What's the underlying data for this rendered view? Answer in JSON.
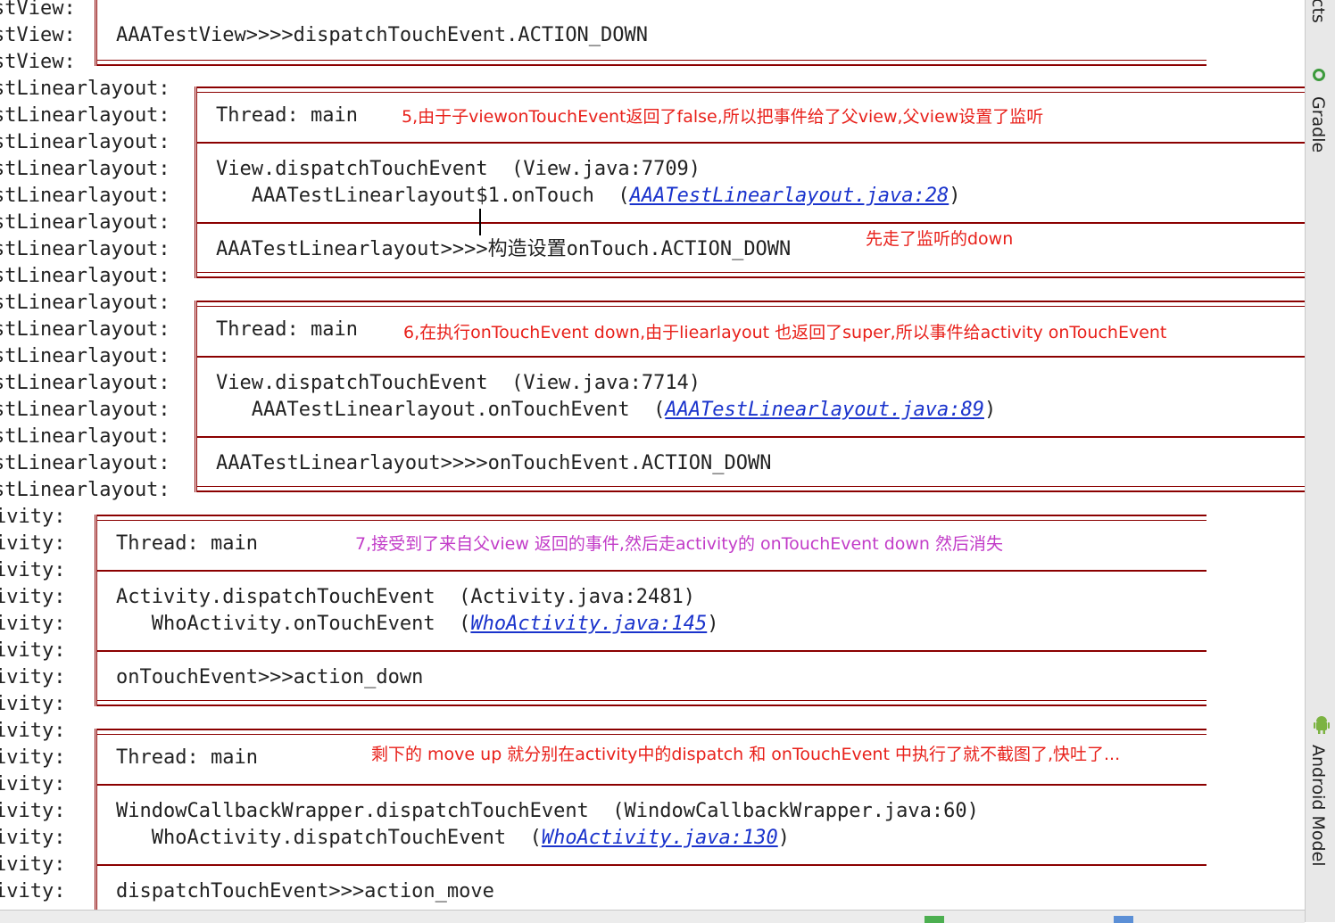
{
  "left_prefixes": {
    "view": "stView:",
    "linear": "stLinearlayout:",
    "activity": "ivity:"
  },
  "sidebar": {
    "tabs": [
      "cts",
      "Gradle",
      "Android Model"
    ]
  },
  "blocks": {
    "block1": {
      "message": "AAATestView>>>>dispatchTouchEvent.ACTION_DOWN"
    },
    "block2": {
      "thread": "Thread: main",
      "note": "5,由于子viewonTouchEvent返回了false,所以把事件给了父view,父view设置了监听",
      "trace1": "View.dispatchTouchEvent  (View.java:7709)",
      "trace2_prefix": "   AAATestLinearlayout$1.onTouch  (",
      "trace2_link": "AAATestLinearlayout.java:28",
      "trace2_suffix": ")",
      "message": "AAATestLinearlayout>>>>构造设置onTouch.ACTION_DOWN",
      "message_note": "先走了监听的down"
    },
    "block3": {
      "thread": "Thread: main",
      "note": "6,在执行onTouchEvent down,由于liearlayout 也返回了super,所以事件给activity onTouchEvent",
      "trace1": "View.dispatchTouchEvent  (View.java:7714)",
      "trace2_prefix": "   AAATestLinearlayout.onTouchEvent  (",
      "trace2_link": "AAATestLinearlayout.java:89",
      "trace2_suffix": ")",
      "message": "AAATestLinearlayout>>>>onTouchEvent.ACTION_DOWN"
    },
    "block4": {
      "thread": "Thread: main",
      "note": "7,接受到了来自父view 返回的事件,然后走activity的 onTouchEvent down 然后消失",
      "trace1": "Activity.dispatchTouchEvent  (Activity.java:2481)",
      "trace2_prefix": "   WhoActivity.onTouchEvent  (",
      "trace2_link": "WhoActivity.java:145",
      "trace2_suffix": ")",
      "message": "onTouchEvent>>>action_down"
    },
    "block5": {
      "thread": "Thread: main",
      "note": "剩下的 move up 就分别在activity中的dispatch 和 onTouchEvent 中执行了就不截图了,快吐了...",
      "trace1": "WindowCallbackWrapper.dispatchTouchEvent  (WindowCallbackWrapper.java:60)",
      "trace2_prefix": "   WhoActivity.dispatchTouchEvent  (",
      "trace2_link": "WhoActivity.java:130",
      "trace2_suffix": ")",
      "message": "dispatchTouchEvent>>>action_move"
    }
  },
  "colors": {
    "frame": "#8b0000",
    "note_red": "#e8201a",
    "note_magenta": "#c23cc8",
    "link": "#1a33cc"
  }
}
